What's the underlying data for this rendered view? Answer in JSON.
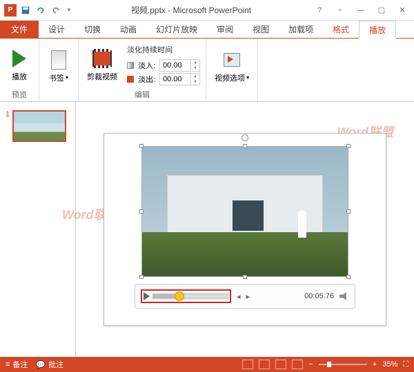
{
  "title": "视频.pptx - Microsoft PowerPoint",
  "qat": {
    "save": "保存",
    "undo": "撤销",
    "redo": "恢复"
  },
  "tabs": {
    "file": "文件",
    "design": "设计",
    "transitions": "切换",
    "animations": "动画",
    "slideshow": "幻灯片放映",
    "review": "审阅",
    "view": "视图",
    "addins": "加载项",
    "format": "格式",
    "playback": "播放"
  },
  "ribbon": {
    "preview": {
      "btn": "播放",
      "label": "预览"
    },
    "bookmark": {
      "btn": "书签",
      "label": ""
    },
    "trim": {
      "btn": "剪裁视频"
    },
    "edit": {
      "fade_title": "淡化持续时间",
      "fadein_label": "淡入:",
      "fadein_val": "00.00",
      "fadeout_label": "淡出:",
      "fadeout_val": "00.00",
      "label": "编辑"
    },
    "options": {
      "btn": "视频选项"
    }
  },
  "thumb": {
    "num": "1"
  },
  "video": {
    "time": "00:05.76"
  },
  "status": {
    "notes": "备注",
    "comments": "批注",
    "zoom": "35%"
  },
  "watermark": "Word联盟"
}
